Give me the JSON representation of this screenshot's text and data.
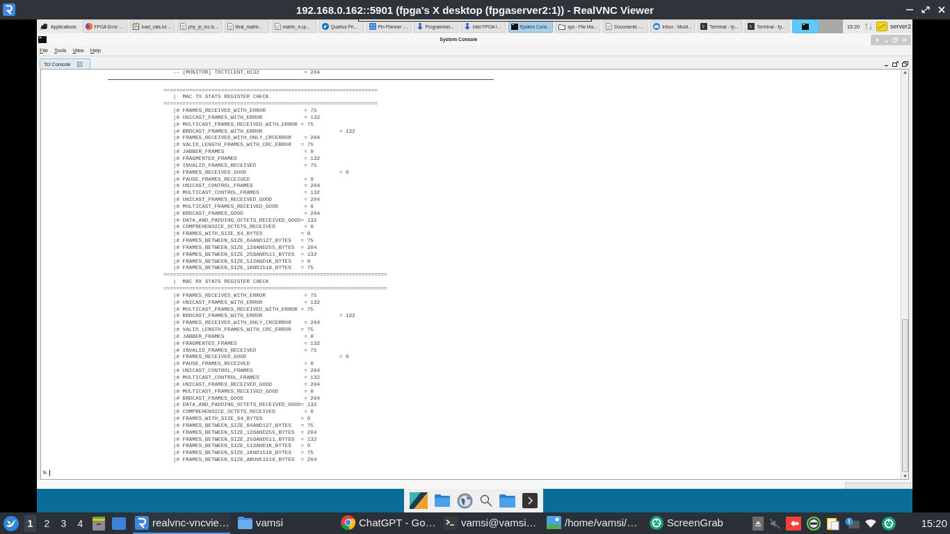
{
  "viewer": {
    "title": "192.168.0.162::5901 (fpga's X desktop (fpgaserver2:1)) - RealVNC Viewer"
  },
  "remote_panel": {
    "menu_button": "Applications",
    "tasks": [
      {
        "kind": "browser",
        "label": "FPGA Error: ...",
        "selected": false,
        "hovered": false
      },
      {
        "kind": "editor",
        "label": "load_vals.tcl ...",
        "selected": false,
        "hovered": false
      },
      {
        "kind": "document",
        "label": "phy_ip_inc.tc...",
        "selected": false,
        "hovered": false
      },
      {
        "kind": "document",
        "label": "final_matrix...",
        "selected": false,
        "hovered": false
      },
      {
        "kind": "document",
        "label": "matrix_4.cp...",
        "selected": false,
        "hovered": false
      },
      {
        "kind": "quartus",
        "label": "Quartus Pri...",
        "selected": false,
        "hovered": false
      },
      {
        "kind": "planner",
        "label": "Pin Planner -...",
        "selected": false,
        "hovered": false
      },
      {
        "kind": "programmer",
        "label": "Programmer...",
        "selected": false,
        "hovered": false
      },
      {
        "kind": "programmer",
        "label": "Intel FPGA I...",
        "selected": false,
        "hovered": false
      },
      {
        "kind": "console",
        "label": "System Cons...",
        "selected": true,
        "hovered": false
      },
      {
        "kind": "files",
        "label": "sys - File Ma...",
        "selected": false,
        "hovered": false
      },
      {
        "kind": "document",
        "label": "Documents -...",
        "selected": false,
        "hovered": false
      },
      {
        "kind": "mail",
        "label": "Inbox - Mozil...",
        "selected": false,
        "hovered": false
      },
      {
        "kind": "terminal",
        "label": "Terminal - fp...",
        "selected": false,
        "hovered": false
      },
      {
        "kind": "terminal",
        "label": "Terminal - fp...",
        "selected": false,
        "hovered": false
      },
      {
        "kind": "console",
        "selected": false,
        "hovered": true
      }
    ],
    "clock": "15:20",
    "hostname": "server2"
  },
  "console": {
    "title": "System Console",
    "menu": [
      "File",
      "Tools",
      "View",
      "Help"
    ],
    "tabs": [
      {
        "label": "Tcl Console",
        "selected": true
      }
    ],
    "output": [
      {
        "kind": "indented",
        "text": "-- (MONITOR) TXCTCLENT_H132              = 204"
      },
      {
        "kind": "divider"
      },
      {
        "kind": "flush",
        "text": "==================================================================="
      },
      {
        "kind": "indented",
        "text": "|  MAC TX STATS REGISTER CHECK"
      },
      {
        "kind": "flush",
        "text": "==================================================================="
      },
      {
        "kind": "indented",
        "text": "|# FRAMES_RECEIVED_WITH_ERROR            = 75"
      },
      {
        "kind": "indented",
        "text": "|# UNICAST_FRAMES_WITH_ERROR             = 132"
      },
      {
        "kind": "indented",
        "text": "|# MULTICAST_FRAMES_RECEIVED_WITH_ERROR = 75"
      },
      {
        "kind": "indented",
        "text": "|# BRDCAST_FRAMES_WITH_ERROR                        = 132"
      },
      {
        "kind": "indented",
        "text": "|# FRAMES_RECEIVED_WITH_ONLY_CRCERROR    = 204"
      },
      {
        "kind": "indented",
        "text": "|# VALID_LENGTH_FRAMES_WITH_CRC_ERROR   = 75"
      },
      {
        "kind": "indented",
        "text": "|# JABBER_FRAMES                         = 0"
      },
      {
        "kind": "indented",
        "text": "|# FRAGMENTED_FRAMES                     = 132"
      },
      {
        "kind": "indented",
        "text": "|# INVALID_FRAMES_RECEIVED               = 75"
      },
      {
        "kind": "indented",
        "text": "|# FRAMES_RECEIVED_GOOD                             = 0"
      },
      {
        "kind": "indented",
        "text": "|# PAUSE_FRAMES_RECEIVED                 = 0"
      },
      {
        "kind": "indented",
        "text": "|# UNICAST_CONTROL_FRAMES                = 204"
      },
      {
        "kind": "indented",
        "text": "|# MULTICAST_CONTROL_FRAMES              = 132"
      },
      {
        "kind": "indented",
        "text": "|# UNICAST_FRAMES_RECEIVED_GOOD          = 204"
      },
      {
        "kind": "indented",
        "text": "|# MULTICAST_FRAMES_RECEIVED_GOOD        = 0"
      },
      {
        "kind": "indented",
        "text": "|# BRDCAST_FRAMES_GOOD                   = 204"
      },
      {
        "kind": "indented",
        "text": "|# DATA_AND_PADDING_OCTETS_RECEIVED_GOOD= 132"
      },
      {
        "kind": "indented",
        "text": "|# COMPREHENSICE_OCTETS_RECEIVED         = 0"
      },
      {
        "kind": "indented",
        "text": "|# FRAMES_WITH_SIZE_64_BYTES            = 0"
      },
      {
        "kind": "indented",
        "text": "|# FRAMES_BETWEEN_SIZE_64AND127_BYTES   = 75"
      },
      {
        "kind": "indented",
        "text": "|# FRAMES_BETWEEN_SIZE_128AND255_BYTES  = 204"
      },
      {
        "kind": "indented",
        "text": "|# FRAMES_BETWEEN_SIZE_256AND511_BYTES  = 132"
      },
      {
        "kind": "indented",
        "text": "|# FRAMES_BETWEEN_SIZE_512AND1K_BYTES   = 0"
      },
      {
        "kind": "indented",
        "text": "|# FRAMES_BETWEEN_SIZE_1KND1518_BYTES   = 75"
      },
      {
        "kind": "flush",
        "text": "======================================================================"
      },
      {
        "kind": "indented",
        "text": "|  MAC RX STATS REGISTER CHECK"
      },
      {
        "kind": "flush",
        "text": "======================================================================"
      },
      {
        "kind": "indented",
        "text": "|# FRAMES_RECEIVED_WITH_ERROR            = 75"
      },
      {
        "kind": "indented",
        "text": "|# UNICAST_FRAMES_WITH_ERROR             = 132"
      },
      {
        "kind": "indented",
        "text": "|# MULTICAST_FRAMES_RECEIVED_WITH_ERROR = 75"
      },
      {
        "kind": "indented",
        "text": "|# BRDCAST_FRAMES_WITH_ERROR                        = 132"
      },
      {
        "kind": "indented",
        "text": "|# FRAMES_RECEIVED_WITH_ONLY_CRCERROR    = 204"
      },
      {
        "kind": "indented",
        "text": "|# VALID_LENGTH_FRAMES_WITH_CRC_ERROR   = 75"
      },
      {
        "kind": "indented",
        "text": "|# JABBER_FRAMES                         = 0"
      },
      {
        "kind": "indented",
        "text": "|# FRAGMENTED_FRAMES                     = 132"
      },
      {
        "kind": "indented",
        "text": "|# INVALID_FRAMES_RECEIVED               = 75"
      },
      {
        "kind": "indented",
        "text": "|# FRAMES_RECEIVED_GOOD                             = 0"
      },
      {
        "kind": "indented",
        "text": "|# PAUSE_FRAMES_RECEIVED                 = 0"
      },
      {
        "kind": "indented",
        "text": "|# UNICAST_CONTROL_FRAMES                = 204"
      },
      {
        "kind": "indented",
        "text": "|# MULTICAST_CONTROL_FRAMES              = 132"
      },
      {
        "kind": "indented",
        "text": "|# UNICAST_FRAMES_RECEIVED_GOOD          = 204"
      },
      {
        "kind": "indented",
        "text": "|# MULTICAST_FRAMES_RECEIVED_GOOD        = 0"
      },
      {
        "kind": "indented",
        "text": "|# BRDCAST_FRAMES_GOOD                   = 204"
      },
      {
        "kind": "indented",
        "text": "|# DATA_AND_PADDING_OCTETS_RECEIVED_GOOD= 132"
      },
      {
        "kind": "indented",
        "text": "|# COMPREHENSICE_OCTETS_RECEIVED         = 0"
      },
      {
        "kind": "indented",
        "text": "|# FRAMES_WITH_SIZE_64_BYTES            = 0"
      },
      {
        "kind": "indented",
        "text": "|# FRAMES_BETWEEN_SIZE_64AND127_BYTES   = 75"
      },
      {
        "kind": "indented",
        "text": "|# FRAMES_BETWEEN_SIZE_128AND255_BYTES  = 204"
      },
      {
        "kind": "indented",
        "text": "|# FRAMES_BETWEEN_SIZE_256AND511_BYTES  = 132"
      },
      {
        "kind": "indented",
        "text": "|# FRAMES_BETWEEN_SIZE_512AND1K_BYTES   = 0"
      },
      {
        "kind": "indented",
        "text": "|# FRAMES_BETWEEN_SIZE_1KND1518_BYTES   = 75"
      },
      {
        "kind": "indented",
        "text": "|# FRAMES_BETWEEN_SIZE_ABOVE1519_BYTES  = 204"
      }
    ],
    "prompt": "%"
  },
  "taskbar": {
    "workspaces": [
      {
        "label": "1",
        "selected": true
      },
      {
        "label": "2",
        "selected": false
      },
      {
        "label": "3",
        "selected": false
      },
      {
        "label": "4",
        "selected": false
      }
    ],
    "tasks": [
      {
        "kind": "vnc",
        "label": "realvnc-vncvie…",
        "selected": true
      },
      {
        "kind": "folder",
        "label": "vamsi",
        "selected": false
      },
      {
        "kind": "browser",
        "label": "ChatGPT - Go…",
        "selected": false
      },
      {
        "kind": "terminal",
        "label": "vamsi@vamsi…",
        "selected": false
      },
      {
        "kind": "image",
        "label": "/home/vamsi/…",
        "selected": false
      },
      {
        "kind": "screengrab",
        "label": "ScreenGrab",
        "selected": false
      }
    ],
    "clock": "15:20"
  }
}
